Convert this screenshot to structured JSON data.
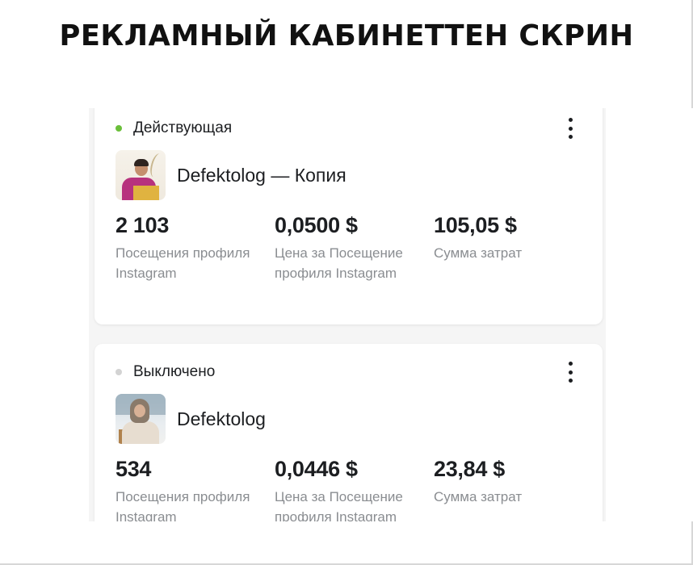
{
  "headline": "РЕКЛАМНЫЙ КАБИНЕТТЕН СКРИН",
  "campaigns": [
    {
      "status": "Действующая",
      "status_color": "#6abf3a",
      "ad_name": "Defektolog — Копия",
      "thumbnail_icon": "ad-creative-thumbnail",
      "metrics": [
        {
          "value": "2 103",
          "label": "Посещения профиля Instagram"
        },
        {
          "value": "0,0500 $",
          "label": "Цена за Посещение профиля Instagram"
        },
        {
          "value": "105,05 $",
          "label": "Сумма затрат"
        }
      ]
    },
    {
      "status": "Выключено",
      "status_color": "#d3d3d3",
      "ad_name": "Defektolog",
      "thumbnail_icon": "ad-creative-thumbnail",
      "metrics": [
        {
          "value": "534",
          "label": "Посещения профиля Instagram"
        },
        {
          "value": "0,0446 $",
          "label": "Цена за Посещение профиля Instagram"
        },
        {
          "value": "23,84 $",
          "label": "Сумма затрат"
        }
      ]
    }
  ],
  "more_icon": "more-vertical-icon"
}
